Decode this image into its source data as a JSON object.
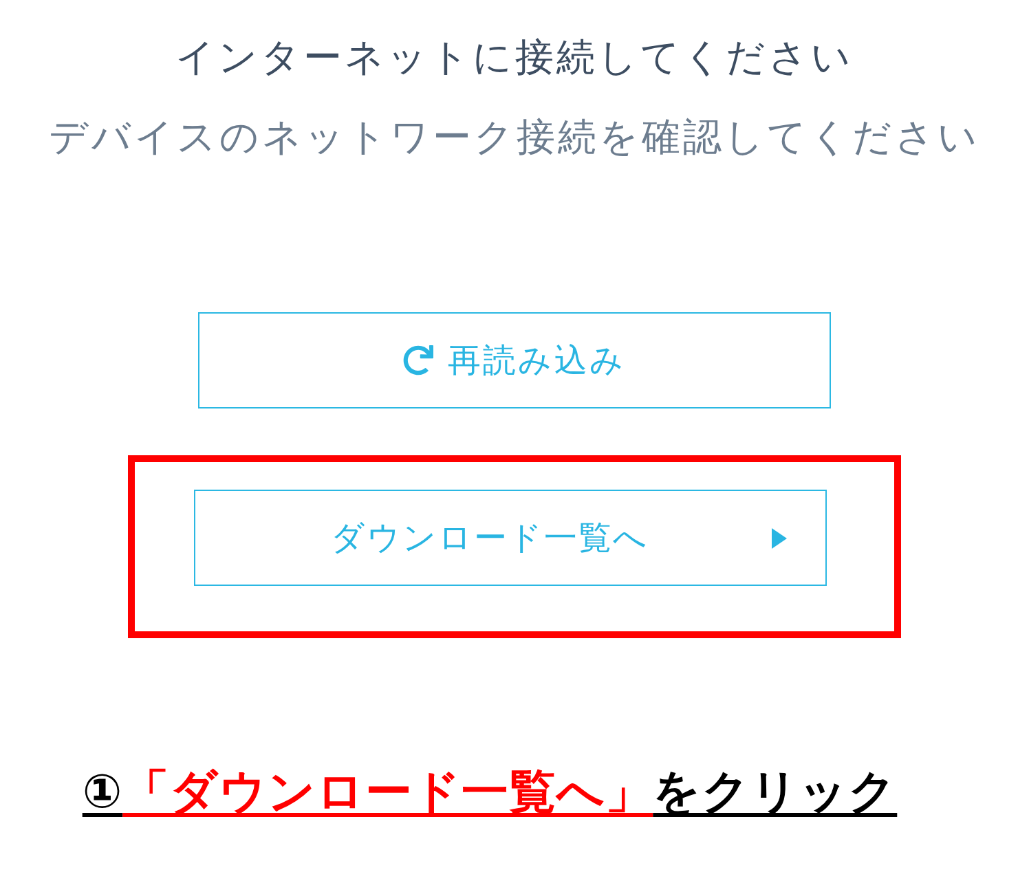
{
  "heading": {
    "title": "インターネットに接続してください",
    "subtitle": "デバイスのネットワーク接続を確認してください"
  },
  "buttons": [
    {
      "kind": "reload",
      "label": "再読み込み",
      "highlighted": false
    },
    {
      "kind": "download-list",
      "label": "ダウンロード一覧へ",
      "highlighted": true
    }
  ],
  "caption": {
    "parts": [
      {
        "text": "①",
        "emphasis": false
      },
      {
        "text": "「ダウンロード一覧へ」",
        "emphasis": true
      },
      {
        "text": "をクリック",
        "emphasis": false
      }
    ]
  }
}
